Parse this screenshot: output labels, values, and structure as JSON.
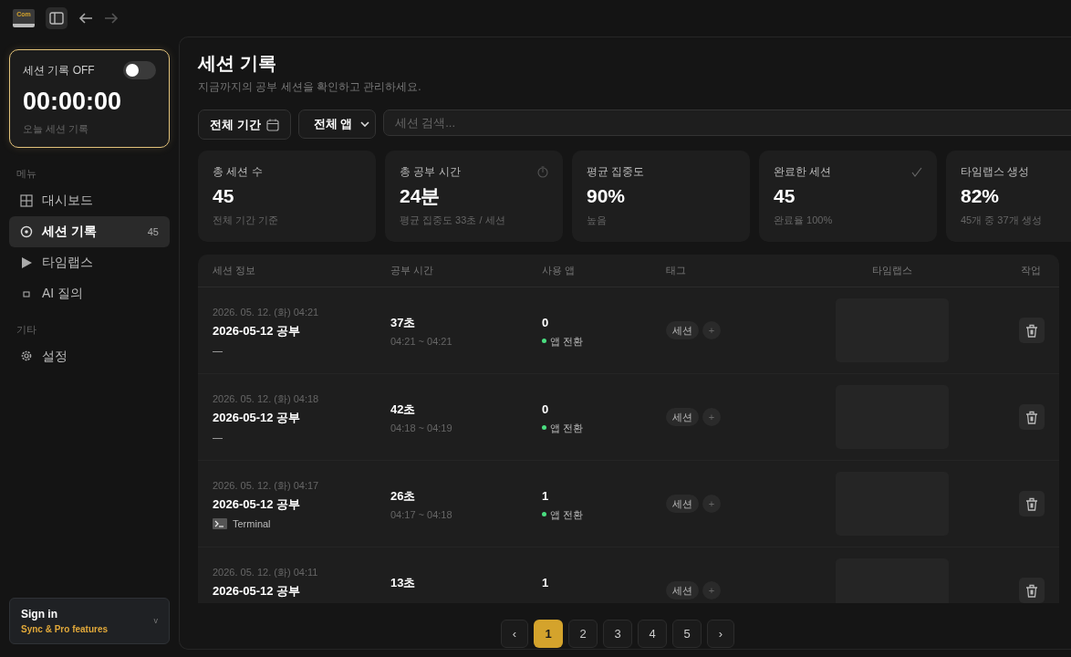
{
  "app_icon_text": "Com",
  "session_card": {
    "label": "세션 기록 OFF",
    "on": false,
    "timer": "00:00:00",
    "caption": "오늘 세션 기록"
  },
  "sidebar": {
    "sections": [
      {
        "label": "메뉴",
        "items": [
          {
            "label": "대시보드",
            "selected": false
          },
          {
            "label": "세션 기록",
            "selected": true,
            "count": "45"
          },
          {
            "label": "타임랩스",
            "selected": false
          },
          {
            "label": "AI 질의",
            "selected": false
          }
        ]
      },
      {
        "label": "기타",
        "items": [
          {
            "label": "설정",
            "selected": false
          }
        ]
      }
    ]
  },
  "sign_in": {
    "title": "Sign in",
    "subtitle": "Sync & Pro features",
    "chevron": "v"
  },
  "page": {
    "title": "세션 기록",
    "subtitle": "지금까지의 공부 세션을 확인하고 관리하세요."
  },
  "filters": {
    "period": "전체 기간",
    "app": "전체 앱",
    "search_placeholder": "세션 검색..."
  },
  "stats": [
    {
      "label": "총 세션 수",
      "value": "45",
      "caption": "전체 기간 기준"
    },
    {
      "label": "총 공부 시간",
      "value": "24분",
      "caption": "평균 집중도 33초 / 세션",
      "kind": "timer"
    },
    {
      "label": "평균 집중도",
      "value": "90%",
      "caption": "높음"
    },
    {
      "label": "완료한 세션",
      "value": "45",
      "caption": "완료율 100%",
      "kind": "check"
    },
    {
      "label": "타임랩스 생성",
      "value": "82%",
      "caption": "45개 중 37개 생성"
    }
  ],
  "table": {
    "columns": [
      "세션 정보",
      "공부 시간",
      "사용 앱",
      "태그",
      "타임랩스",
      "작업"
    ],
    "rows": [
      {
        "date": "2026. 05. 12. (화) 04:21",
        "title": "2026-05-12 공부",
        "note": "—",
        "duration": "37초",
        "range": "04:21 ~ 04:21",
        "app_count": "0",
        "app_label": "앱 전환",
        "tags": [
          "세션"
        ],
        "add_tag": "+"
      },
      {
        "date": "2026. 05. 12. (화) 04:18",
        "title": "2026-05-12 공부",
        "note": "—",
        "duration": "42초",
        "range": "04:18 ~ 04:19",
        "app_count": "0",
        "app_label": "앱 전환",
        "tags": [
          "세션"
        ],
        "add_tag": "+"
      },
      {
        "date": "2026. 05. 12. (화) 04:17",
        "title": "2026-05-12 공부",
        "app_name": "Terminal",
        "duration": "26초",
        "range": "04:17 ~ 04:18",
        "app_count": "1",
        "app_label": "앱 전환",
        "tags": [
          "세션"
        ],
        "add_tag": "+"
      },
      {
        "date": "2026. 05. 12. (화) 04:11",
        "title": "2026-05-12 공부",
        "duration": "13초",
        "app_count": "1",
        "tags": [
          "세션"
        ],
        "add_tag": "+"
      }
    ]
  },
  "pagination": {
    "prev": "‹",
    "next": "›",
    "pages": [
      {
        "label": "1",
        "selected": true
      },
      {
        "label": "2",
        "selected": false
      },
      {
        "label": "3",
        "selected": false
      },
      {
        "label": "4",
        "selected": false
      },
      {
        "label": "5",
        "selected": false
      }
    ]
  }
}
